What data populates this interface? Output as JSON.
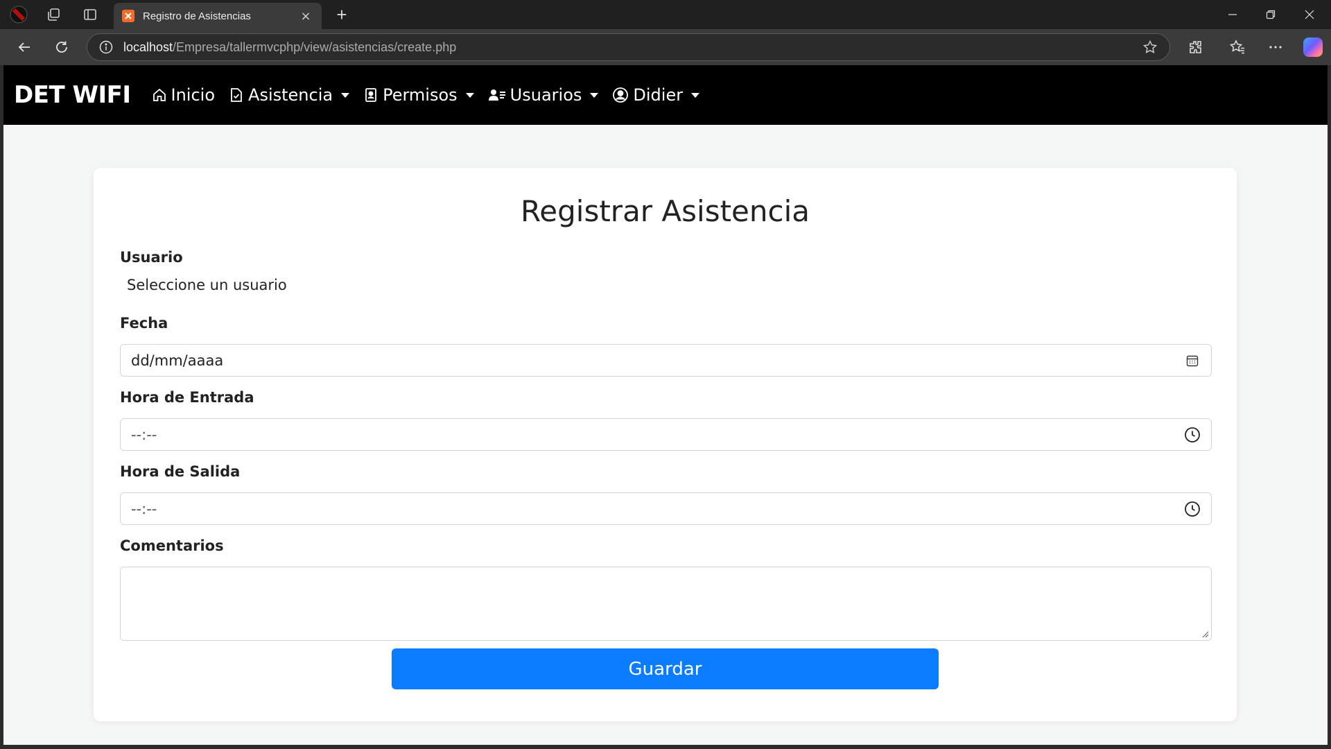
{
  "browser": {
    "tab_title": "Registro de Asistencias",
    "tab_close": "×",
    "new_tab": "+",
    "url_host": "localhost",
    "url_path": "/Empresa/tallermvcphp/view/asistencias/create.php"
  },
  "navbar": {
    "brand": "DET WIFI",
    "items": [
      {
        "label": "Inicio",
        "icon": "home-icon",
        "dropdown": false
      },
      {
        "label": "Asistencia",
        "icon": "file-check-icon",
        "dropdown": true
      },
      {
        "label": "Permisos",
        "icon": "badge-icon",
        "dropdown": true
      },
      {
        "label": "Usuarios",
        "icon": "users-icon",
        "dropdown": true
      },
      {
        "label": "Didier",
        "icon": "user-circle-icon",
        "dropdown": true
      }
    ]
  },
  "form": {
    "title": "Registrar Asistencia",
    "usuario_label": "Usuario",
    "usuario_value": "Seleccione un usuario",
    "fecha_label": "Fecha",
    "fecha_value": "dd/mm/aaaa",
    "entrada_label": "Hora de Entrada",
    "entrada_value": "--:--",
    "salida_label": "Hora de Salida",
    "salida_value": "--:--",
    "comentarios_label": "Comentarios",
    "comentarios_value": "",
    "submit_label": "Guardar"
  },
  "colors": {
    "navbar_bg": "#000000",
    "page_bg": "#f4f5f5",
    "primary_button": "#0a7cff",
    "tab_favicon": "#f26b28"
  }
}
